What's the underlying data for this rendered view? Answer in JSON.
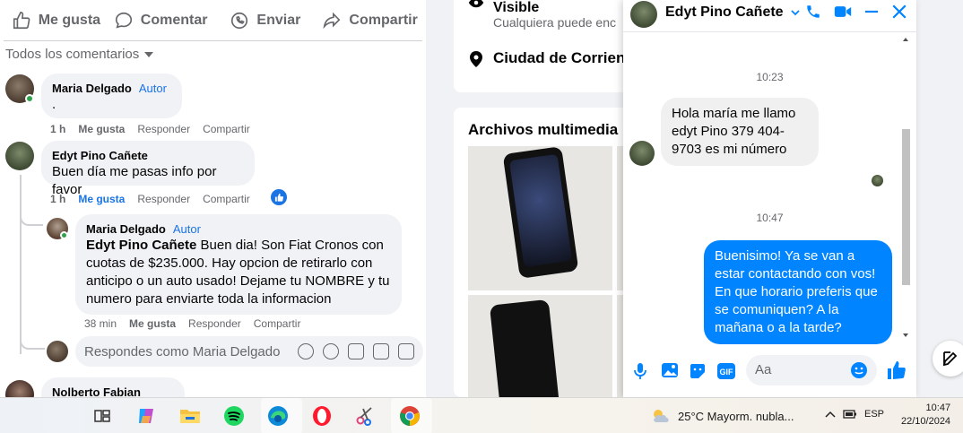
{
  "post_actions": {
    "like": "Me gusta",
    "comment": "Comentar",
    "send": "Enviar",
    "share": "Compartir"
  },
  "comments_sort": "Todos los comentarios",
  "comments": [
    {
      "author": "Maria Delgado",
      "badge": "Autor",
      "text": ".",
      "time": "1 h",
      "like": "Me gusta",
      "reply": "Responder",
      "share": "Compartir"
    },
    {
      "author": "Edyt Pino Cañete",
      "text": "Buen día me pasas info por favor",
      "time": "1 h",
      "like": "Me gusta",
      "reply": "Responder",
      "share": "Compartir"
    }
  ],
  "reply": {
    "author": "Maria Delgado",
    "badge": "Autor",
    "mention": "Edyt Pino Cañete",
    "text": " Buen dia! Son Fiat Cronos con cuotas de $235.000. Hay opcion de retirarlo con anticipo o un auto usado! Dejame tu NOMBRE y tu numero para enviarte toda la informacion",
    "time": "38 min",
    "like": "Me gusta",
    "reply_label": "Responder",
    "share": "Compartir"
  },
  "reply_box_placeholder": "Respondes como Maria Delgado",
  "next_comment_author": "Nolberto Fabian Maciel",
  "profile": {
    "visibility": "Visible",
    "visibility_sub": "Cualquiera puede enc",
    "city": "Ciudad de Corrient",
    "media_title": "Archivos multimedia re"
  },
  "chat": {
    "name": "Edyt Pino Cañete",
    "time1": "10:23",
    "incoming": "Hola maría me llamo edyt Pino 379 404-9703 es mi número",
    "time2": "10:47",
    "outgoing": "Buenisimo! Ya se van a estar contactando con vos! En que horario preferis que se comuniquen? A la mañana o a la tarde?",
    "input_placeholder": "Aa",
    "accent": "#0084ff"
  },
  "taskbar": {
    "weather": "25°C  Mayorm. nubla...",
    "lang": "ESP",
    "time": "10:47",
    "date": "22/10/2024"
  }
}
